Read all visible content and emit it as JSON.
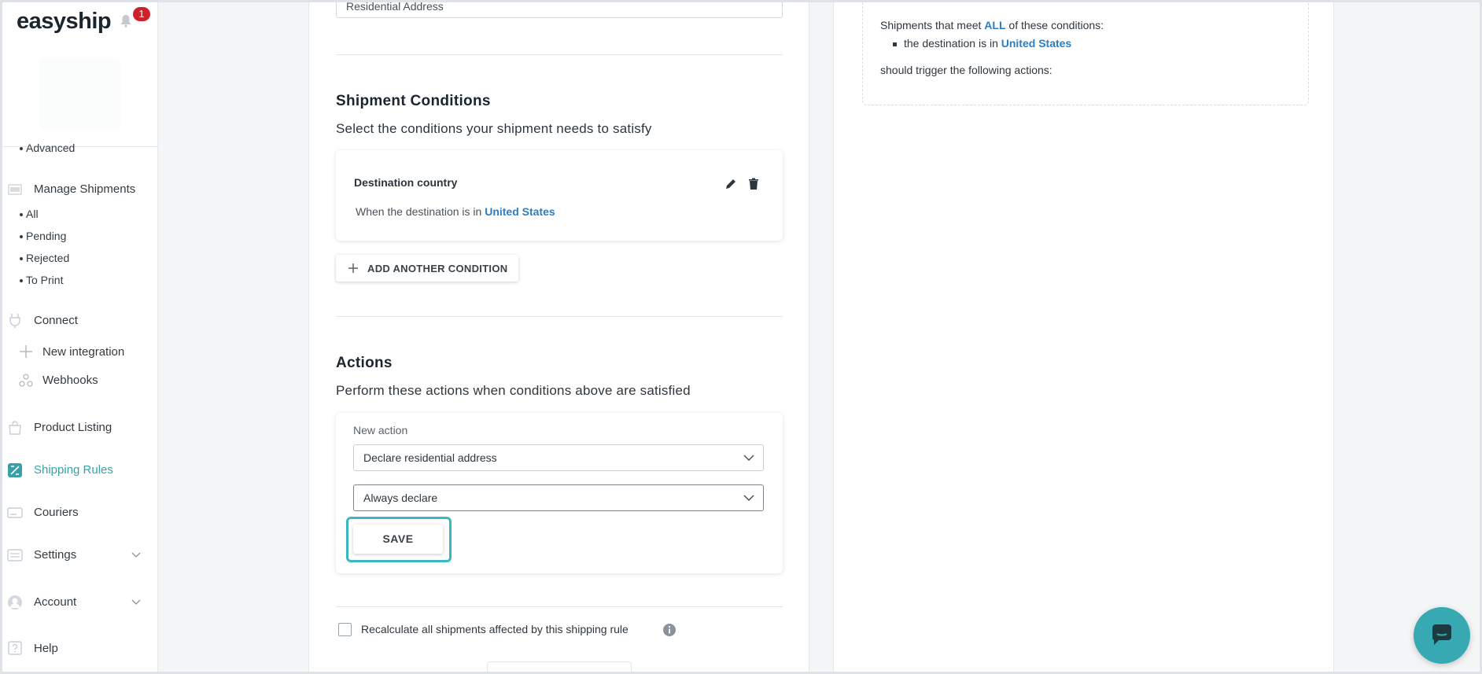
{
  "sidebar": {
    "brand": "easyship",
    "notification_count": "1",
    "items": {
      "advanced": "Advanced",
      "manage_shipments": "Manage Shipments",
      "all": "All",
      "pending": "Pending",
      "rejected": "Rejected",
      "to_print": "To Print",
      "connect": "Connect",
      "new_integration": "New integration",
      "webhooks": "Webhooks",
      "product_listing": "Product Listing",
      "shipping_rules": "Shipping Rules",
      "couriers": "Couriers",
      "settings": "Settings",
      "account": "Account",
      "help": "Help"
    }
  },
  "form": {
    "address_value": "Residential Address",
    "conditions_title": "Shipment Conditions",
    "conditions_subtitle": "Select the conditions your shipment needs to satisfy",
    "condition": {
      "title": "Destination country",
      "text_prefix": "When the destination is in",
      "country": "United States"
    },
    "add_condition_label": "ADD ANOTHER CONDITION",
    "actions_title": "Actions",
    "actions_subtitle": "Perform these actions when conditions above are satisfied",
    "new_action_label": "New action",
    "action_select": "Declare residential address",
    "declare_select": "Always declare",
    "save_label": "SAVE",
    "recalculate_label": "Recalculate all shipments affected by this shipping rule"
  },
  "summary": {
    "prefix": "Shipments that meet",
    "all": "ALL",
    "suffix": "of these conditions:",
    "bullet_prefix": "the destination is in",
    "bullet_country": "United States",
    "trigger": "should trigger the following actions:"
  },
  "colors": {
    "accent": "#39a0a7",
    "link": "#2a7ec6",
    "badge": "#d0202b",
    "chat": "#37a9b3"
  }
}
